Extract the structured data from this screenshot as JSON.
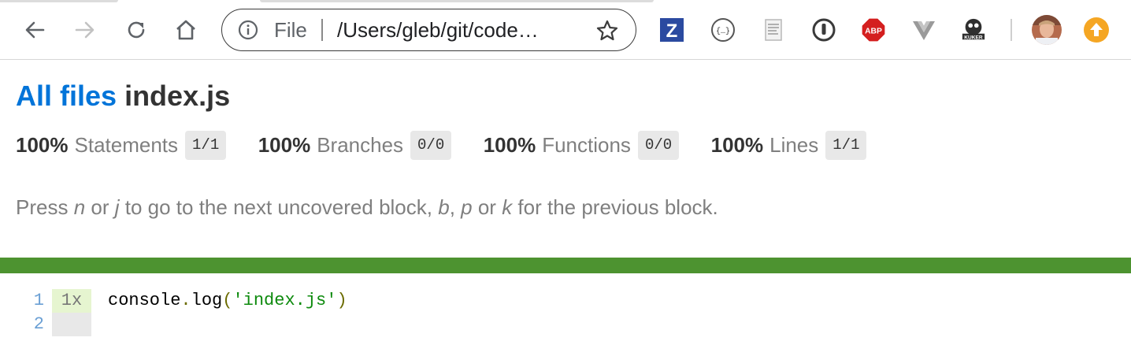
{
  "browser": {
    "address_scheme": "File",
    "address_url": "/Users/gleb/git/code…",
    "extensions": [
      {
        "name": "zotero-icon",
        "glyph": "Z"
      },
      {
        "name": "json-viewer-icon",
        "glyph": "{…}"
      },
      {
        "name": "document-extension-icon",
        "glyph": ""
      },
      {
        "name": "password-manager-icon",
        "glyph": ""
      },
      {
        "name": "adblock-plus-icon",
        "glyph": "ABP"
      },
      {
        "name": "vue-devtools-icon",
        "glyph": ""
      },
      {
        "name": "kuker-icon",
        "glyph": "KUKER"
      },
      {
        "name": "profile-avatar",
        "glyph": ""
      },
      {
        "name": "update-icon",
        "glyph": ""
      }
    ]
  },
  "page": {
    "breadcrumb_link": "All files",
    "file_name": "index.js",
    "stats": [
      {
        "pct": "100%",
        "label": "Statements",
        "fraction": "1/1"
      },
      {
        "pct": "100%",
        "label": "Branches",
        "fraction": "0/0"
      },
      {
        "pct": "100%",
        "label": "Functions",
        "fraction": "0/0"
      },
      {
        "pct": "100%",
        "label": "Lines",
        "fraction": "1/1"
      }
    ],
    "hint": {
      "t1": "Press ",
      "k1": "n",
      "t2": " or ",
      "k2": "j",
      "t3": " to go to the next uncovered block, ",
      "k3": "b",
      "t4": ", ",
      "k4": "p",
      "t5": " or ",
      "k5": "k",
      "t6": " for the previous block."
    },
    "status_color": "#4d9330"
  },
  "code": {
    "lines": [
      {
        "number": "1",
        "count": "1x",
        "tokens": {
          "ident": "console",
          "dot": ".",
          "method": "log",
          "open": "(",
          "str": "'index.js'",
          "close": ")"
        }
      },
      {
        "number": "2",
        "count": ""
      }
    ]
  }
}
